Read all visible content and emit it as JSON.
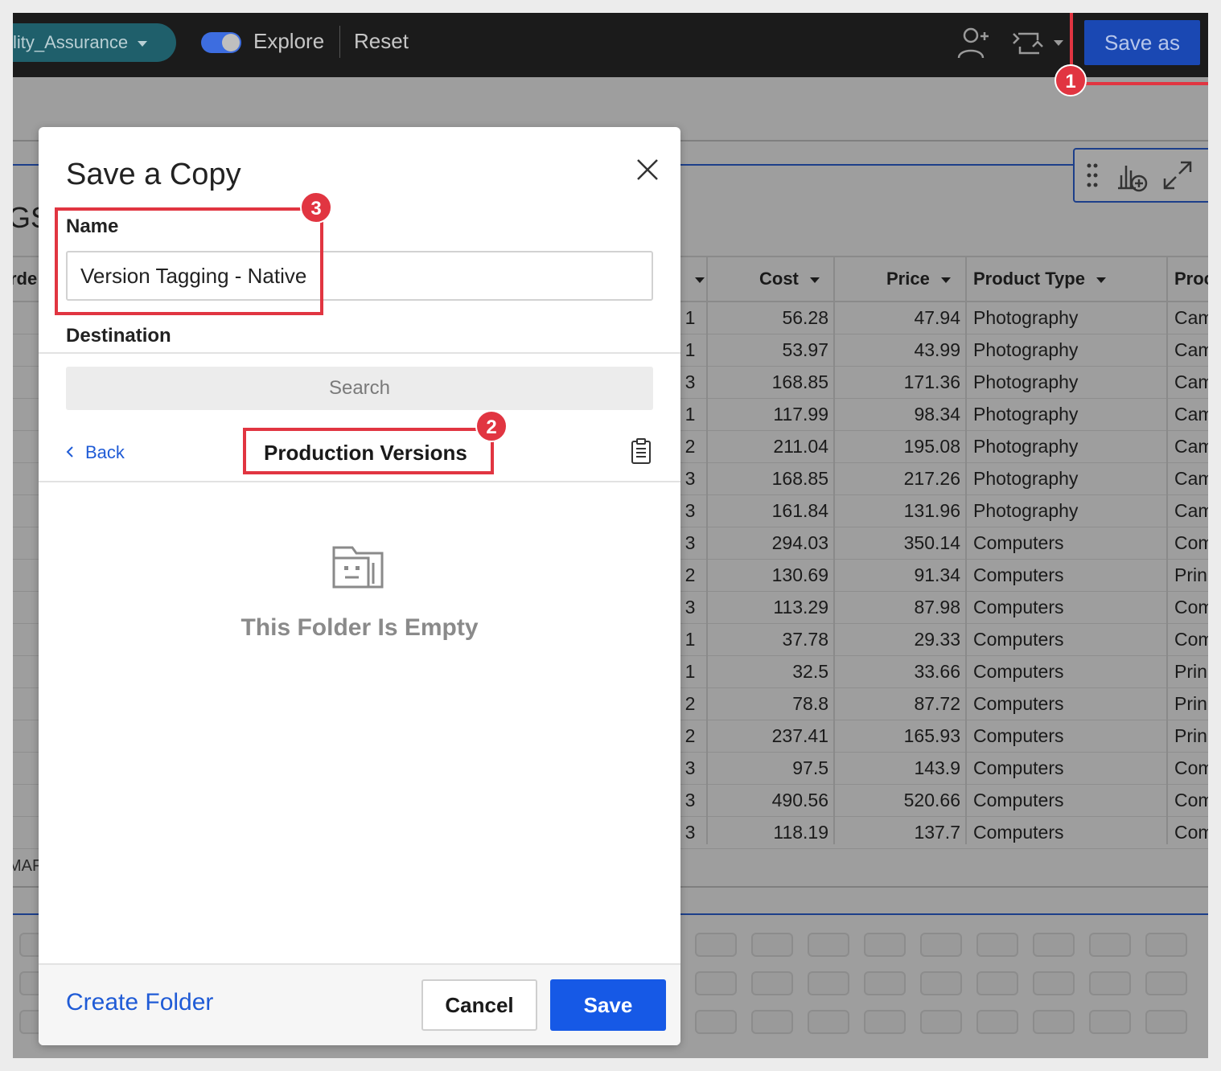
{
  "topbar": {
    "workspace_label": "lity_Assurance",
    "explore_label": "Explore",
    "reset_label": "Reset",
    "save_as_label": "Save as",
    "explore_toggle_on": true
  },
  "background": {
    "section_heading": "GS",
    "column_prefix": "rde",
    "marker_text": "MAF"
  },
  "table": {
    "columns": [
      "Cost",
      "Price",
      "Product Type",
      "Proc"
    ],
    "rows": [
      {
        "qty": "1",
        "cost": "56.28",
        "price": "47.94",
        "type": "Photography",
        "prod": "Cam"
      },
      {
        "qty": "1",
        "cost": "53.97",
        "price": "43.99",
        "type": "Photography",
        "prod": "Cam"
      },
      {
        "qty": "3",
        "cost": "168.85",
        "price": "171.36",
        "type": "Photography",
        "prod": "Cam"
      },
      {
        "qty": "1",
        "cost": "117.99",
        "price": "98.34",
        "type": "Photography",
        "prod": "Cam"
      },
      {
        "qty": "2",
        "cost": "211.04",
        "price": "195.08",
        "type": "Photography",
        "prod": "Cam"
      },
      {
        "qty": "3",
        "cost": "168.85",
        "price": "217.26",
        "type": "Photography",
        "prod": "Cam"
      },
      {
        "qty": "3",
        "cost": "161.84",
        "price": "131.96",
        "type": "Photography",
        "prod": "Cam"
      },
      {
        "qty": "3",
        "cost": "294.03",
        "price": "350.14",
        "type": "Computers",
        "prod": "Com"
      },
      {
        "qty": "2",
        "cost": "130.69",
        "price": "91.34",
        "type": "Computers",
        "prod": "Prin"
      },
      {
        "qty": "3",
        "cost": "113.29",
        "price": "87.98",
        "type": "Computers",
        "prod": "Com"
      },
      {
        "qty": "1",
        "cost": "37.78",
        "price": "29.33",
        "type": "Computers",
        "prod": "Com"
      },
      {
        "qty": "1",
        "cost": "32.5",
        "price": "33.66",
        "type": "Computers",
        "prod": "Prin"
      },
      {
        "qty": "2",
        "cost": "78.8",
        "price": "87.72",
        "type": "Computers",
        "prod": "Prin"
      },
      {
        "qty": "2",
        "cost": "237.41",
        "price": "165.93",
        "type": "Computers",
        "prod": "Prin"
      },
      {
        "qty": "3",
        "cost": "97.5",
        "price": "143.9",
        "type": "Computers",
        "prod": "Com"
      },
      {
        "qty": "3",
        "cost": "490.56",
        "price": "520.66",
        "type": "Computers",
        "prod": "Com"
      },
      {
        "qty": "3",
        "cost": "118.19",
        "price": "137.7",
        "type": "Computers",
        "prod": "Com"
      }
    ]
  },
  "modal": {
    "title": "Save a Copy",
    "name_label": "Name",
    "name_value": "Version Tagging - Native",
    "destination_label": "Destination",
    "search_placeholder": "Search",
    "back_label": "Back",
    "folder_title": "Production Versions",
    "empty_message": "This Folder Is Empty",
    "create_folder_label": "Create Folder",
    "cancel_label": "Cancel",
    "save_label": "Save"
  },
  "annotations": {
    "badges": [
      "1",
      "2",
      "3"
    ],
    "color": "#e13541"
  },
  "colors": {
    "accent": "#1659e6",
    "link": "#1f5bd6",
    "topbar": "#1b1b1b"
  },
  "icons": [
    "share-user-icon",
    "sync-icon",
    "close-icon",
    "chevron-left-icon",
    "clipboard-icon",
    "empty-folder-icon",
    "drag-handle-icon",
    "add-chart-icon",
    "expand-icon"
  ]
}
